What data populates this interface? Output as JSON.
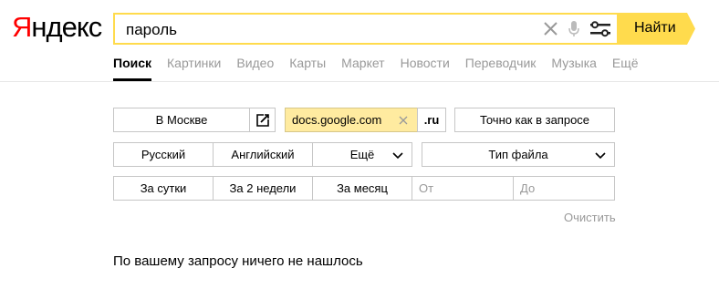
{
  "logo": {
    "first": "Я",
    "rest": "ндекс"
  },
  "search": {
    "query": "пароль",
    "button_label": "Найти"
  },
  "tabs": [
    {
      "label": "Поиск",
      "active": true
    },
    {
      "label": "Картинки"
    },
    {
      "label": "Видео"
    },
    {
      "label": "Карты"
    },
    {
      "label": "Маркет"
    },
    {
      "label": "Новости"
    },
    {
      "label": "Переводчик"
    },
    {
      "label": "Музыка"
    },
    {
      "label": "Ещё"
    }
  ],
  "filters": {
    "region": "В Москве",
    "site": "docs.google.com",
    "domain": ".ru",
    "exact": "Точно как в запросе",
    "lang_ru": "Русский",
    "lang_en": "Английский",
    "lang_more": "Ещё",
    "filetype": "Тип файла",
    "day": "За сутки",
    "two_weeks": "За 2 недели",
    "month": "За месяц",
    "from_placeholder": "От",
    "to_placeholder": "До",
    "clear": "Очистить"
  },
  "message": "По вашему запросу ничего не нашлось",
  "colors": {
    "accent": "#ffdb4d",
    "logo_red": "#ff0000",
    "selected_bg": "#ffeba0"
  }
}
